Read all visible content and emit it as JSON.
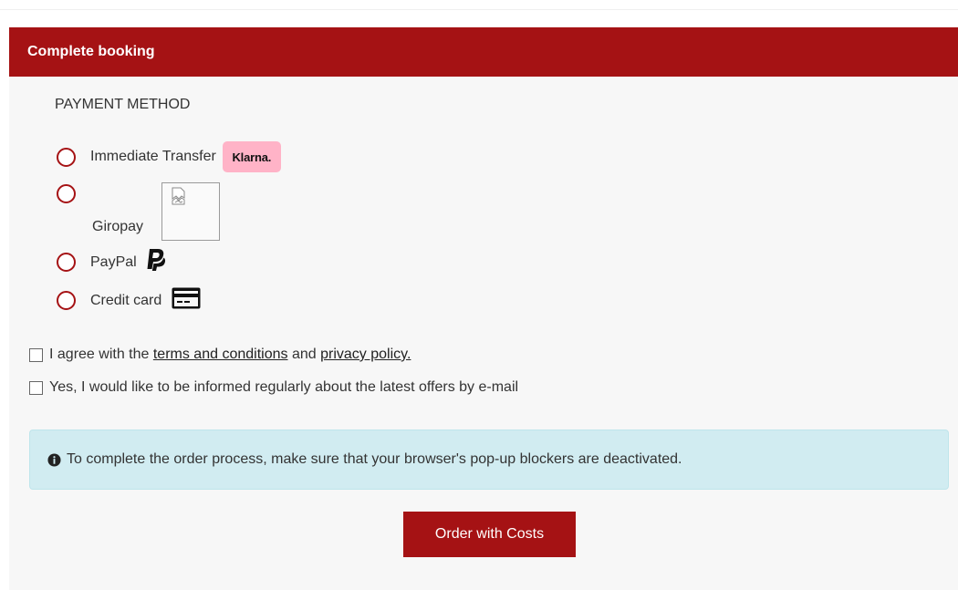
{
  "booking": {
    "title": "Complete booking",
    "payment_method_heading": "PAYMENT METHOD",
    "methods": [
      {
        "label": "Immediate Transfer",
        "badge": "Klarna.",
        "icon": "klarna-logo"
      },
      {
        "label": "Giropay",
        "icon": "broken-image-icon"
      },
      {
        "label": "PayPal",
        "icon": "paypal-icon"
      },
      {
        "label": "Credit card",
        "icon": "credit-card-icon"
      }
    ],
    "terms": {
      "prefix": "I agree with the",
      "terms_link": "terms and conditions",
      "middle": "and",
      "privacy_link": "privacy policy."
    },
    "newsletter_label": "Yes, I would like to be informed regularly about the latest offers by e-mail",
    "info_message": "To complete the order process, make sure that your browser's pop-up blockers are deactivated.",
    "order_button": "Order with Costs"
  },
  "colors": {
    "brand": "#a51214",
    "panel_bg": "#f7f7f7",
    "info_bg": "#d1ecf1",
    "klarna_pink": "#ffb3c7"
  }
}
